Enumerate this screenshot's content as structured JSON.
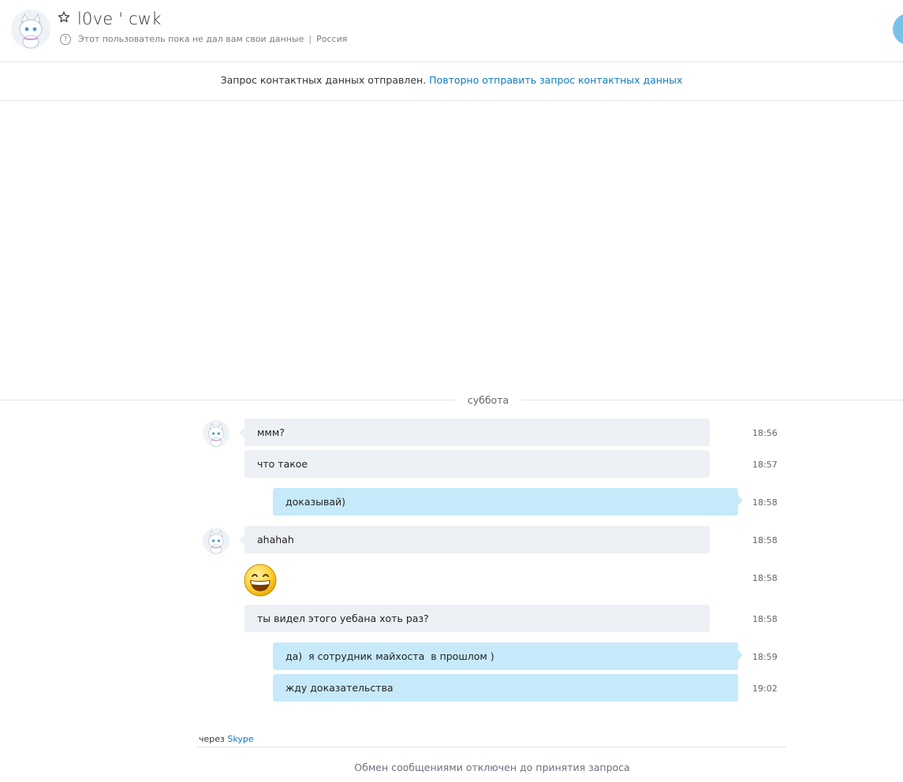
{
  "header": {
    "contact_name": "l0ve ' cwk",
    "status_text": "Этот пользователь пока не дал вам свои данные",
    "location": "Россия",
    "separator": "|",
    "help_glyph": "?"
  },
  "notice": {
    "text": "Запрос контактных данных отправлен.",
    "resend_link": "Повторно отправить запрос контактных данных"
  },
  "day_label": "суббота",
  "messages": [
    {
      "text": "ммм?",
      "time": "18:56",
      "direction": "in"
    },
    {
      "text": "что такое",
      "time": "18:57",
      "direction": "in"
    },
    {
      "text": "доказывай)",
      "time": "18:58",
      "direction": "out"
    },
    {
      "text": "ahahah",
      "time": "18:58",
      "direction": "in"
    },
    {
      "emoticon": "grinning-face-icon",
      "time": "18:58",
      "direction": "in"
    },
    {
      "text": "ты видел этого уебана хоть раз?",
      "time": "18:58",
      "direction": "in"
    },
    {
      "text": "да)  я сотрудник майхоста  в прошлом )",
      "time": "18:59",
      "direction": "out"
    },
    {
      "text": "жду доказательства",
      "time": "19:02",
      "direction": "out"
    }
  ],
  "footer": {
    "via_prefix": "через",
    "via_link": "Skype",
    "disabled_text": "Обмен сообщениями отключен до принятия запроса"
  },
  "colors": {
    "accent_link": "#0f7bbd",
    "incoming_bubble": "#edf0f5",
    "outgoing_bubble": "#c7eafb",
    "call_button": "#7ac1ea"
  }
}
